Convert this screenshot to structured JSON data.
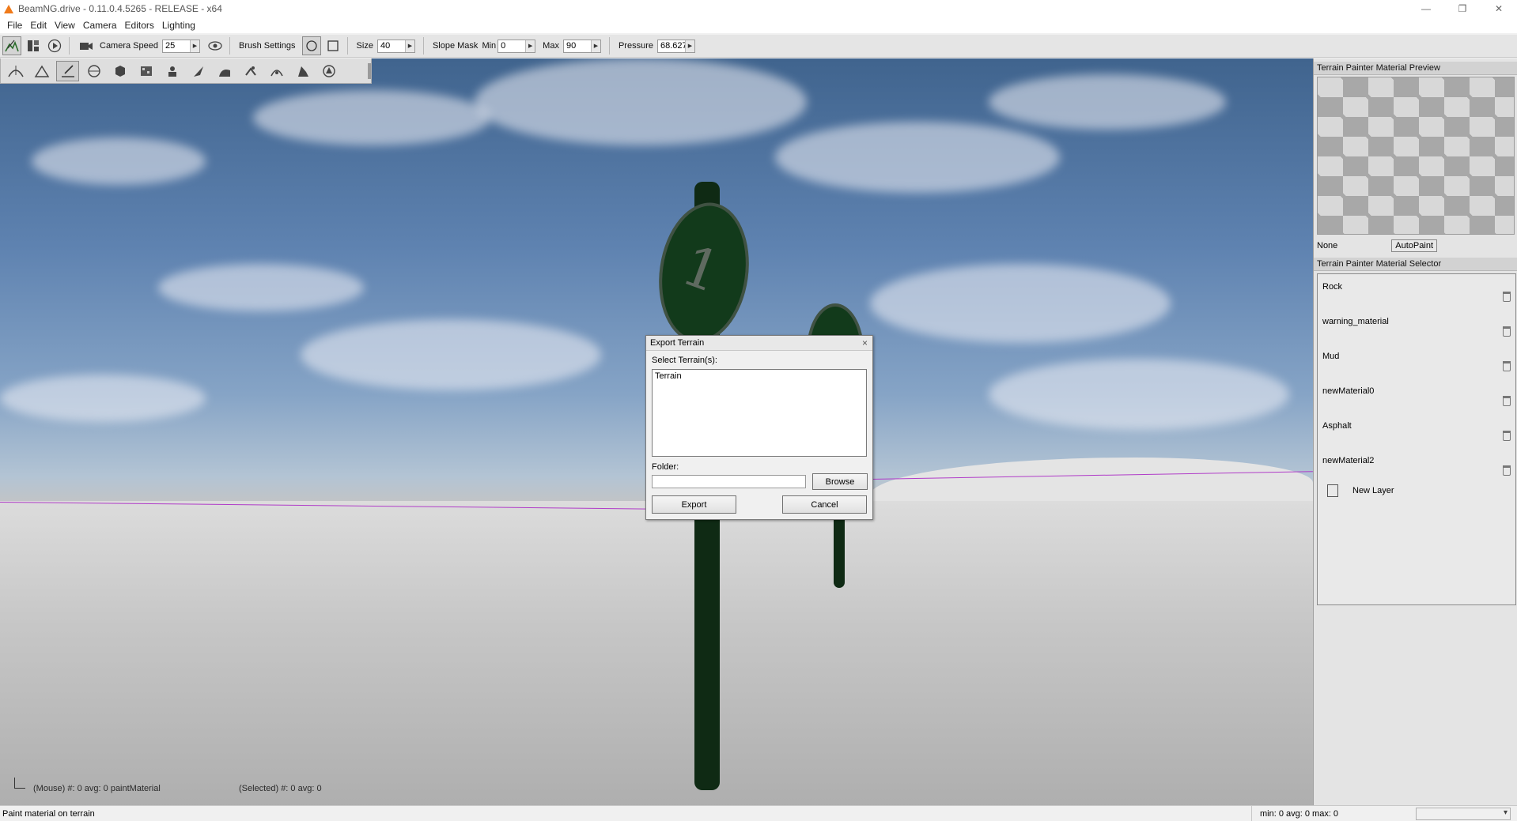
{
  "window": {
    "title": "BeamNG.drive - 0.11.0.4.5265 - RELEASE - x64",
    "minimize": "—",
    "restore": "❐",
    "close": "✕"
  },
  "menu": [
    "File",
    "Edit",
    "View",
    "Camera",
    "Editors",
    "Lighting"
  ],
  "toolbar": {
    "camera_speed_label": "Camera Speed",
    "camera_speed_value": "25",
    "brush_settings_label": "Brush Settings",
    "size_label": "Size",
    "size_value": "40",
    "slope_mask_label": "Slope Mask",
    "min_label": "Min",
    "min_value": "0",
    "max_label": "Max",
    "max_value": "90",
    "pressure_label": "Pressure",
    "pressure_value": "68.627"
  },
  "viewport": {
    "sign_number": "1",
    "mouse_info": "(Mouse) #: 0  avg: 0 paintMaterial",
    "selected_info": "(Selected) #: 0  avg: 0"
  },
  "preview_panel": {
    "header": "Terrain Painter Material Preview",
    "material_name": "None",
    "autopaint_label": "AutoPaint"
  },
  "selector_panel": {
    "header": "Terrain Painter Material Selector",
    "materials": [
      "Rock",
      "warning_material",
      "Mud",
      "newMaterial0",
      "Asphalt",
      "newMaterial2"
    ],
    "new_layer_label": "New Layer"
  },
  "dialog": {
    "title": "Export Terrain",
    "close_glyph": "×",
    "select_label": "Select Terrain(s):",
    "terrains": [
      "Terrain"
    ],
    "folder_label": "Folder:",
    "folder_value": "",
    "browse_label": "Browse",
    "export_label": "Export",
    "cancel_label": "Cancel"
  },
  "status": {
    "left": "Paint material on terrain",
    "right": "min: 0  avg: 0  max: 0"
  },
  "colors": {
    "accent_orange": "#f07a1a",
    "sign_green": "#123a1b",
    "boundary_purple": "#b03cc8"
  }
}
